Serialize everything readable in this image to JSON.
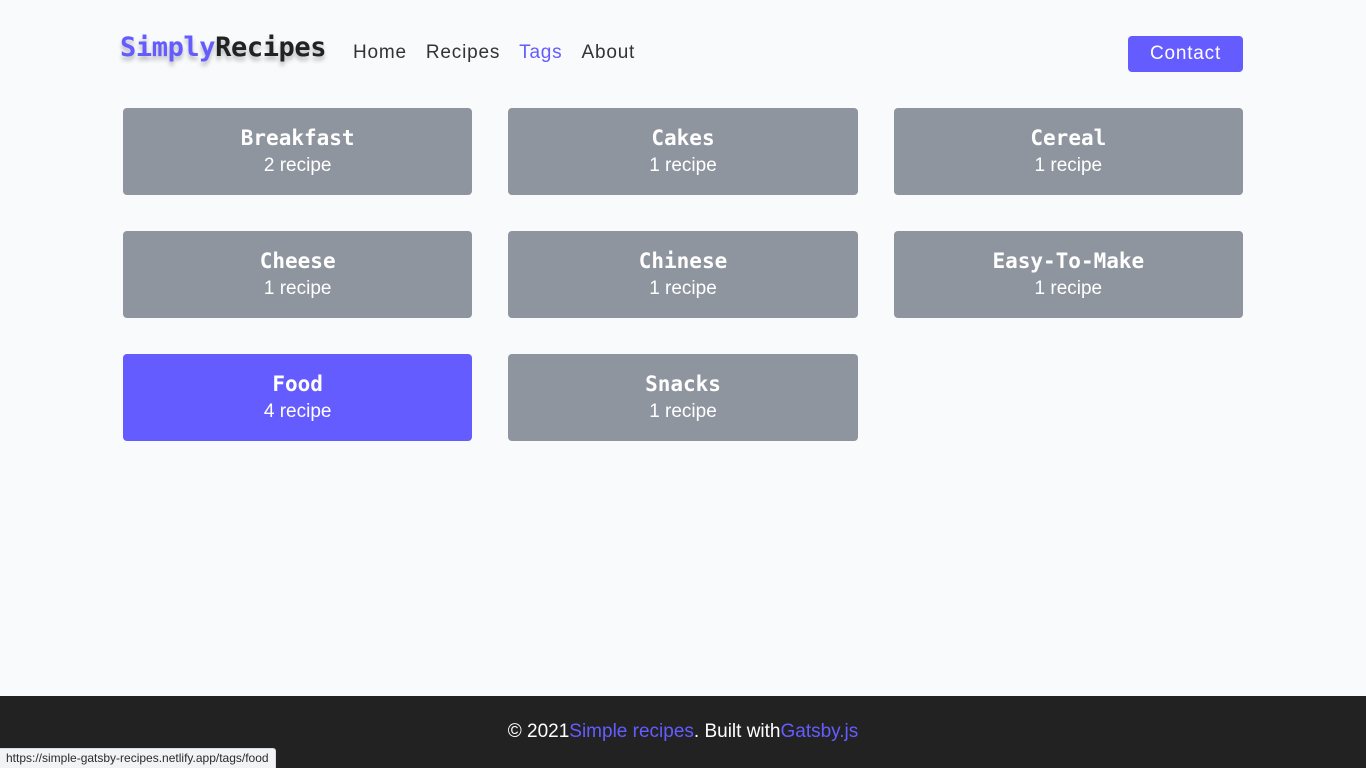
{
  "brand": {
    "accent_text": "Simply",
    "rest_text": "Recipes",
    "accent_color": "#645cff"
  },
  "nav": {
    "items": [
      {
        "label": "Home",
        "active": false
      },
      {
        "label": "Recipes",
        "active": false
      },
      {
        "label": "Tags",
        "active": true
      },
      {
        "label": "About",
        "active": false
      }
    ],
    "contact_label": "Contact"
  },
  "tags": [
    {
      "name": "Breakfast",
      "count": "2 recipe",
      "active": false
    },
    {
      "name": "Cakes",
      "count": "1 recipe",
      "active": false
    },
    {
      "name": "Cereal",
      "count": "1 recipe",
      "active": false
    },
    {
      "name": "Cheese",
      "count": "1 recipe",
      "active": false
    },
    {
      "name": "Chinese",
      "count": "1 recipe",
      "active": false
    },
    {
      "name": "Easy-To-Make",
      "count": "1 recipe",
      "active": false
    },
    {
      "name": "Food",
      "count": "4 recipe",
      "active": true
    },
    {
      "name": "Snacks",
      "count": "1 recipe",
      "active": false
    }
  ],
  "footer": {
    "prefix": "© 2021 ",
    "site_link": "Simple recipes",
    "middle": ". Built with ",
    "framework_link": "Gatsby.js"
  },
  "status_bar": {
    "url": "https://simple-gatsby-recipes.netlify.app/tags/food"
  },
  "colors": {
    "accent": "#645cff",
    "card_inactive": "#8f959e",
    "footer_bg": "#222222",
    "page_bg": "#f8fafc"
  }
}
